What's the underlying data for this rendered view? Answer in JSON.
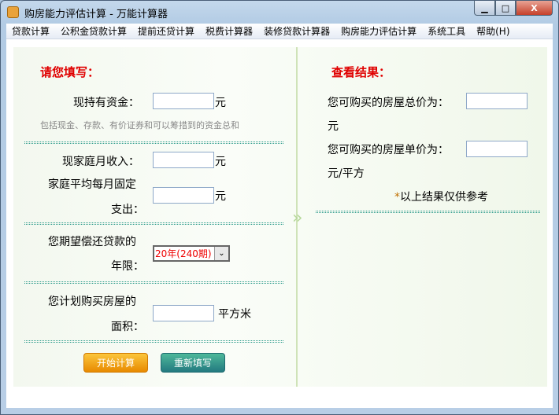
{
  "window": {
    "title": "购房能力评估计算 - 万能计算器"
  },
  "menu": [
    "贷款计算",
    "公积金贷款计算",
    "提前还贷计算",
    "税费计算器",
    "装修贷款计算器",
    "购房能力评估计算",
    "系统工具",
    "帮助(H)"
  ],
  "left": {
    "heading": "请您填写：",
    "funds_label": "现持有资金：",
    "unit_yuan": "元",
    "funds_hint": "包括现金、存款、有价证券和可以筹措到的资金总和",
    "income_label": "现家庭月收入：",
    "expense_label1": "家庭平均每月固定",
    "expense_label2": "支出：",
    "years_label1": "您期望偿还贷款的",
    "years_label2": "年限：",
    "years_value": "20年(240期)",
    "area_label1": "您计划购买房屋的",
    "area_label2": "面积：",
    "unit_sqm": "平方米",
    "calc_button": "开始计算",
    "reset_button": "重新填写"
  },
  "right": {
    "heading": "查看结果：",
    "total_label": "您可购买的房屋总价为：",
    "unit_yuan": "元",
    "unit_label": "您可购买的房屋单价为：",
    "unit_per": "元/平方",
    "note_star": "*",
    "note": "以上结果仅供参考"
  }
}
